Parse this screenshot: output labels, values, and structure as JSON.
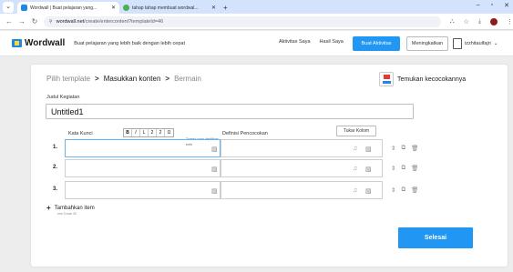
{
  "browser": {
    "tabs": [
      {
        "title": "Wordwall | Buat pelajaran yang...",
        "active": true,
        "favicon_color": "#1e88e5"
      },
      {
        "title": "tahap tahap membuat wordwal...",
        "active": false,
        "favicon_color": "#4caf50"
      }
    ],
    "menu_glyph": "⌄",
    "new_tab_glyph": "+",
    "close_glyph": "✕",
    "window_controls": {
      "minimize": "–",
      "maximize": "▫",
      "close": "✕"
    },
    "address": {
      "site_glyph": "⚲",
      "domain": "wordwall.net",
      "path": "/create/entercontent?templateId=46"
    },
    "nav": {
      "back": "←",
      "forward": "→",
      "reload": "↻"
    },
    "toolbar_right": {
      "translate": "⛬",
      "star": "☆",
      "download": "⤓",
      "more": "⋮"
    }
  },
  "header": {
    "logo_text": "Wordwall",
    "tagline": "Buat pelajaran yang lebih baik dengan lebih cepat",
    "links": [
      "Aktivitas Saya",
      "Hasil Saya"
    ],
    "create_button": "Buat Aktivitas",
    "upgrade_button": "Meningkatkan",
    "user_name": "izzhitaulfajri",
    "user_caret": "⌄"
  },
  "colors": {
    "accent": "#2196f3",
    "brand_blue": "#1e88e5",
    "brand_yellow": "#fdd835"
  },
  "editor": {
    "breadcrumb": {
      "step1": "Pilih template",
      "step2": "Masukkan konten",
      "step3": "Bermain",
      "separator": ">"
    },
    "template_name": "Temukan kecocokannya",
    "title_label": "Judul Kegiatan",
    "title_value": "Untitled1",
    "col_keyword": "Kata Kunci",
    "col_definition": "Definisi Pencocokan",
    "format_buttons": [
      "B",
      "I",
      "L",
      "2",
      "2",
      "Ω"
    ],
    "format_tip": "Tombol yang diaktifkan",
    "swap_button": "Tukar Kolom",
    "keyword_placeholder": "entri",
    "rows": [
      {
        "number": "1.",
        "keyword": "",
        "definition": ""
      },
      {
        "number": "2.",
        "keyword": "",
        "definition": ""
      },
      {
        "number": "3.",
        "keyword": "",
        "definition": ""
      }
    ],
    "icons": {
      "image": "▨",
      "mic": "♫",
      "updown": "⇕",
      "copy": "⧉",
      "trash": "🗑"
    },
    "add_item_label": "Tambahkan item",
    "add_item_plus": "+",
    "add_item_sub": "min 3  max 30",
    "finish_button": "Selesai"
  }
}
